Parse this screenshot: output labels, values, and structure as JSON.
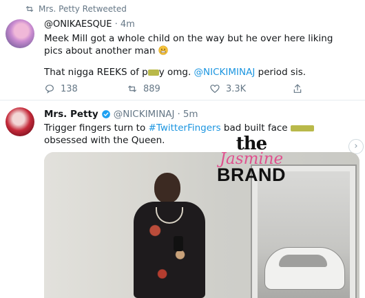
{
  "retweet_header": {
    "label": "Mrs. Petty Retweeted"
  },
  "tweet1": {
    "handle": "@ONIKAESQUE",
    "separator": "·",
    "time": "4m",
    "line1": "Meek Mill got a whole child on the way but he over here liking pics about another man",
    "line2_a": "That nigga REEKS of p",
    "line2_b": "y omg. ",
    "mention": "@NICKIMINAJ",
    "line2_c": " period sis.",
    "emoji_icon": "grimace-emoji",
    "replies": "138",
    "retweets": "889",
    "likes": "3.3K"
  },
  "tweet2": {
    "name": "Mrs. Petty",
    "handle": "@NICKIMINAJ",
    "separator": "·",
    "time": "5m",
    "text_a": "Trigger fingers turn to ",
    "hashtag": "#TwitterFingers",
    "text_b": " bad built face ",
    "text_c": "obsessed with the Queen."
  },
  "watermark": {
    "the": "the",
    "jasmine": "Jasmine",
    "brand": "BRAND"
  },
  "colors": {
    "link": "#1b95e0",
    "muted": "#657786",
    "censor": "#b9b94a",
    "brand_pink": "#e0508e"
  }
}
